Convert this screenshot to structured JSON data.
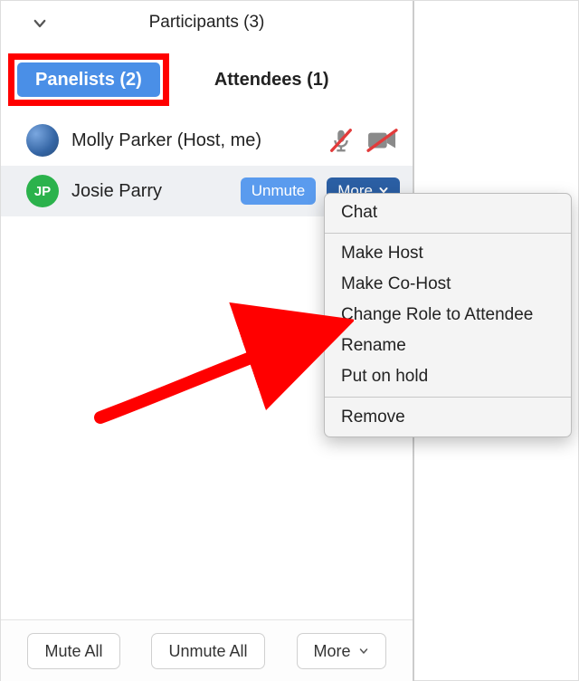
{
  "header": {
    "title": "Participants (3)"
  },
  "tabs": {
    "panelists": "Panelists (2)",
    "attendees": "Attendees (1)"
  },
  "participants": [
    {
      "initials": "",
      "name": "Molly Parker (Host, me)",
      "avatar_color": "#3a6fb8",
      "muted_icon": "microphone-muted",
      "video_icon": "video-off"
    },
    {
      "initials": "JP",
      "name": "Josie Parry",
      "avatar_color": "#2bb24c",
      "unmute_label": "Unmute",
      "more_label": "More"
    }
  ],
  "context_menu": {
    "items_group1": [
      "Chat"
    ],
    "items_group2": [
      "Make Host",
      "Make Co-Host",
      "Change Role to Attendee",
      "Rename",
      "Put on hold"
    ],
    "items_group3": [
      "Remove"
    ]
  },
  "bottom_bar": {
    "mute_all": "Mute All",
    "unmute_all": "Unmute All",
    "more": "More"
  },
  "colors": {
    "accent_blue": "#4a8fe7",
    "dark_blue": "#2b5fa4",
    "red": "#ff0000",
    "green": "#2bb24c",
    "mute_red": "#e23b3b"
  }
}
